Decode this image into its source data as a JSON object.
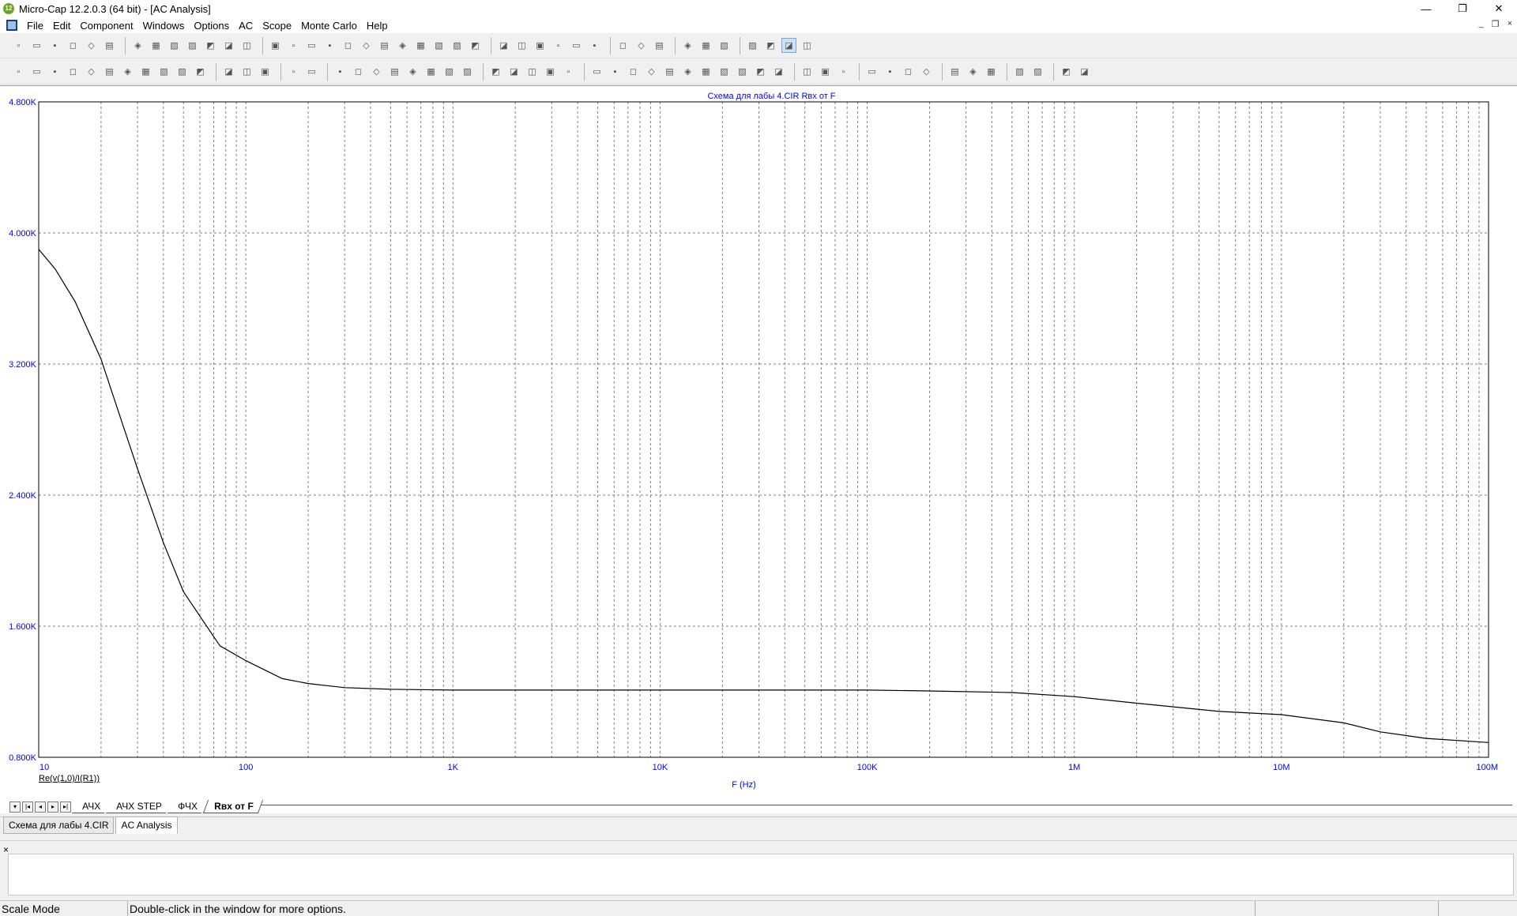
{
  "window": {
    "title": "Micro-Cap 12.2.0.3 (64 bit) - [AC Analysis]",
    "app_icon_text": "12",
    "controls": [
      "—",
      "❐",
      "✕"
    ]
  },
  "menu": {
    "items": [
      "File",
      "Edit",
      "Component",
      "Windows",
      "Options",
      "AC",
      "Scope",
      "Monte Carlo",
      "Help"
    ],
    "mdi_controls": [
      "_",
      "❐",
      "×"
    ]
  },
  "toolbar1": {
    "icons": [
      "new-icon",
      "open-icon",
      "save-icon",
      "save-all-icon",
      "print-preview-icon",
      "print-icon",
      "undo-icon",
      "redo-icon",
      "cut-icon",
      "copy-icon",
      "paste-icon",
      "delete-icon",
      "select-all-icon",
      "ground-icon",
      "resistor-icon",
      "capacitor-icon",
      "inductor-icon",
      "diode-icon",
      "transistor-icon",
      "mosfet-icon",
      "opamp-icon",
      "source-icon",
      "battery-icon",
      "node-icon",
      "probe-icon",
      "cascade-icon",
      "tile-v-icon",
      "tile-h-icon",
      "window-icon",
      "window2-icon",
      "calculator-icon",
      "doc-icon",
      "info-icon",
      "globe-icon",
      "props-icon",
      "list-icon",
      "table-icon",
      "flag-icon",
      "tools-icon",
      "chart-icon",
      "chart-check-icon"
    ]
  },
  "toolbar2": {
    "icons": [
      "pointer-icon",
      "pan-icon",
      "globe-dropdown-icon",
      "scale-icon",
      "fit-icon",
      "graph-icon",
      "graph2-icon",
      "graph3-icon",
      "function-icon",
      "text-tool-icon",
      "palette-icon",
      "run-icon",
      "stop-icon",
      "pause-icon",
      "pen-icon",
      "pen2-icon",
      "box-icon",
      "box2-icon",
      "align-icon",
      "align2-icon",
      "align3-icon",
      "align4-icon",
      "grid-icon",
      "grid2-icon",
      "zoom-icon",
      "zoom2-icon",
      "zoom3-icon",
      "zoom4-icon",
      "mark-icon",
      "peak-icon",
      "valley-icon",
      "high-icon",
      "low-icon",
      "inflect-icon",
      "slope-icon",
      "bottom-icon",
      "top-icon",
      "global-icon",
      "global2-icon",
      "clipboard-icon",
      "tag-icon",
      "point-icon",
      "scale-mode-icon",
      "scale-mode2-icon",
      "zoom-in-icon",
      "zoom-out-icon",
      "zoom-fit-icon",
      "grid-dots-icon",
      "font-icon",
      "text-size-icon",
      "copy-plot-icon",
      "paste-plot-icon",
      "cursor-icon",
      "cursor2-icon"
    ]
  },
  "plot": {
    "title": "Схема для лабы 4.CIR Rвх от F",
    "y_tick_labels": [
      "4.800K",
      "4.000K",
      "3.200K",
      "2.400K",
      "1.600K",
      "0.800K"
    ],
    "x_tick_labels": [
      "10",
      "100",
      "1K",
      "10K",
      "100K",
      "1M",
      "10M",
      "100M"
    ],
    "x_axis_label": "F (Hz)",
    "trace_label": "Re(v(1,0)/I(R1))",
    "trace_color": "#000000",
    "title_color": "#0000ff",
    "grid_color": "#808080"
  },
  "chart_data": {
    "type": "line",
    "title": "Схема для лабы 4.CIR Rвх от F",
    "xlabel": "F (Hz)",
    "ylabel": "",
    "x_scale": "log",
    "xlim": [
      10,
      100000000
    ],
    "ylim": [
      800,
      4800
    ],
    "y_ticks": [
      800,
      1600,
      2400,
      3200,
      4000,
      4800
    ],
    "grid": true,
    "series": [
      {
        "name": "Re(v(1,0)/I(R1))",
        "x": [
          10,
          12,
          15,
          20,
          25,
          30,
          40,
          50,
          75,
          100,
          150,
          200,
          300,
          500,
          1000,
          2000,
          5000,
          10000,
          50000,
          100000,
          200000,
          500000,
          1000000,
          2000000,
          5000000,
          10000000,
          20000000,
          30000000,
          50000000,
          100000000
        ],
        "y": [
          3900,
          3780,
          3580,
          3230,
          2860,
          2560,
          2110,
          1810,
          1480,
          1390,
          1280,
          1250,
          1225,
          1215,
          1210,
          1210,
          1210,
          1210,
          1210,
          1210,
          1205,
          1195,
          1170,
          1130,
          1080,
          1060,
          1010,
          955,
          915,
          890
        ]
      }
    ]
  },
  "sheet_tabs": {
    "nav": [
      "▾",
      "|◂",
      "◂",
      "▸",
      "▸|"
    ],
    "tabs": [
      "АЧХ",
      "АЧХ STEP",
      "ФЧХ",
      "Rвх от F"
    ],
    "active": "Rвх от F"
  },
  "doc_tabs": [
    "Схема для лабы 4.CIR",
    "AC Analysis"
  ],
  "doc_tab_active": "AC Analysis",
  "output": {
    "close_glyph": "×"
  },
  "status": {
    "mode": "Scale Mode",
    "message": "Double-click in the window for more options."
  }
}
